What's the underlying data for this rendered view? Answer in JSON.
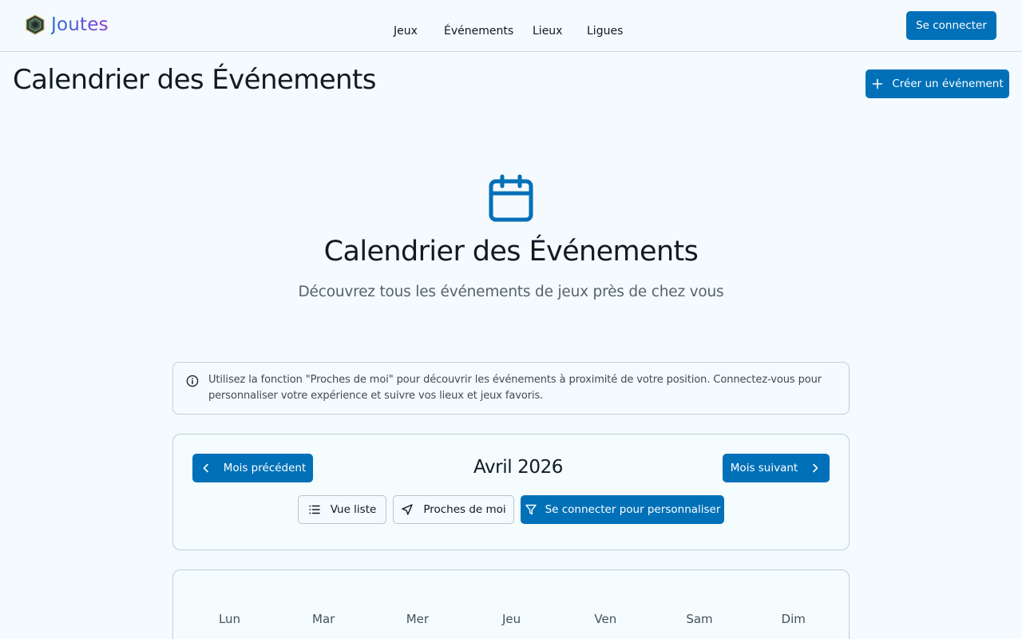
{
  "header": {
    "brand": "Joutes",
    "nav": [
      "Jeux",
      "Événements",
      "Lieux",
      "Ligues"
    ],
    "login_label": "Se connecter"
  },
  "page": {
    "title": "Calendrier des Événements",
    "create_label": "Créer un événement"
  },
  "hero": {
    "icon": "calendar-icon",
    "title": "Calendrier des Événements",
    "subtitle": "Découvrez tous les événements de jeux près de chez vous"
  },
  "info": {
    "text": "Utilisez la fonction \"Proches de moi\" pour découvrir les événements à proximité de votre position. Connectez-vous pour personnaliser votre expérience et suivre vos lieux et jeux favoris."
  },
  "controls": {
    "prev_label": "Mois précédent",
    "month": "Avril 2026",
    "next_label": "Mois suivant",
    "list_label": "Vue liste",
    "near_label": "Proches de moi",
    "personalize_label": "Se connecter pour personnaliser"
  },
  "calendar": {
    "weekdays": [
      "Lun",
      "Mar",
      "Mer",
      "Jeu",
      "Ven",
      "Sam",
      "Dim"
    ]
  },
  "colors": {
    "primary": "#0070b8",
    "background": "#f4fafd",
    "border": "#bed0d8"
  }
}
